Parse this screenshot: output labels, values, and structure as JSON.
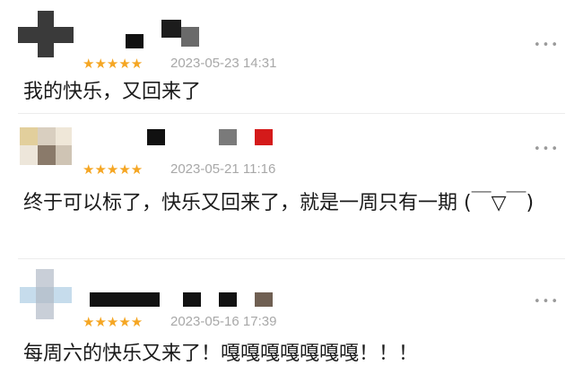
{
  "more_icon": "more-dots-icon",
  "star_color": "#f5a623",
  "reviews": [
    {
      "stars": "★★★★★",
      "rating": 5,
      "date": "2023-05-23 14:31",
      "text": "我的快乐，又回来了",
      "more": "•••"
    },
    {
      "stars": "★★★★★",
      "rating": 5,
      "date": "2023-05-21 11:16",
      "text": "终于可以标了，快乐又回来了，就是一周只有一期 (￣▽￣)",
      "more": "•••"
    },
    {
      "stars": "★★★★★",
      "rating": 5,
      "date": "2023-05-16 17:39",
      "text": "每周六的快乐又来了！嘎嘎嘎嘎嘎嘎嘎！！！",
      "more": "•••"
    }
  ]
}
